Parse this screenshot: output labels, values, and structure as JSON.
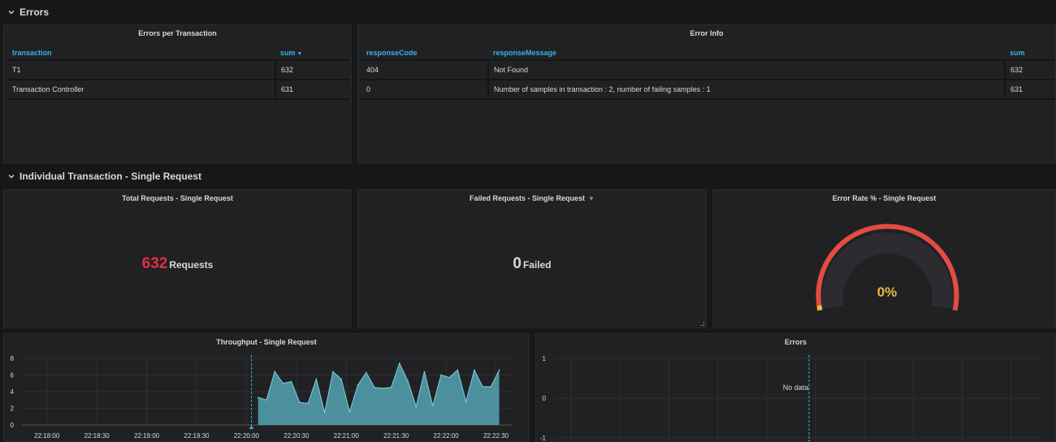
{
  "rows": {
    "errors": {
      "title": "Errors"
    },
    "individual": {
      "title": "Individual Transaction - Single Request"
    }
  },
  "errors_per_transaction": {
    "title": "Errors per Transaction",
    "columns": [
      "transaction",
      "sum"
    ],
    "rows": [
      [
        "T1",
        "632"
      ],
      [
        "Transaction Controller",
        "631"
      ]
    ]
  },
  "error_info": {
    "title": "Error Info",
    "columns": [
      "responseCode",
      "responseMessage",
      "sum"
    ],
    "rows": [
      [
        "404",
        "Not Found",
        "632"
      ],
      [
        "0",
        "Number of samples in transaction : 2, number of failing samples : 1",
        "631"
      ]
    ]
  },
  "total_requests": {
    "title": "Total Requests - Single Request",
    "value": "632",
    "unit": "Requests",
    "color": "#e02f44"
  },
  "failed_requests": {
    "title": "Failed Requests - Single Request",
    "value": "0",
    "unit": "Failed",
    "color": "#d8d9da"
  },
  "error_rate": {
    "title": "Error Rate % - Single Request",
    "value": "0%",
    "percent": 0,
    "gauge_color": "#e24d42",
    "value_color": "#eab839"
  },
  "throughput": {
    "title": "Throughput - Single Request"
  },
  "errors_chart": {
    "title": "Errors",
    "no_data": "No data"
  },
  "chart_data": [
    {
      "type": "area",
      "title": "Throughput - Single Request",
      "ylim": [
        0,
        8
      ],
      "y_ticks": [
        "0",
        "2",
        "4",
        "6",
        "8"
      ],
      "x_ticks": [
        "22:18:00",
        "22:18:30",
        "22:19:00",
        "22:19:30",
        "22:20:00",
        "22:20:30",
        "22:21:00",
        "22:21:30",
        "22:22:00",
        "22:22:30"
      ],
      "x_range": [
        "22:17:45",
        "22:22:40"
      ],
      "annotation_time": "22:20:03",
      "grid": true,
      "color": "#5bb5c7",
      "series": [
        {
          "x": [
            "22:20:07",
            "22:20:12",
            "22:20:17",
            "22:20:22",
            "22:20:27",
            "22:20:32",
            "22:20:37",
            "22:20:42",
            "22:20:47",
            "22:20:52",
            "22:20:57",
            "22:21:02",
            "22:21:07",
            "22:21:12",
            "22:21:17",
            "22:21:22",
            "22:21:27",
            "22:21:32",
            "22:21:37",
            "22:21:42",
            "22:21:47",
            "22:21:52",
            "22:21:57",
            "22:22:02",
            "22:22:07",
            "22:22:12",
            "22:22:17",
            "22:22:22",
            "22:22:27",
            "22:22:32"
          ],
          "values": [
            3.3,
            3.0,
            6.4,
            5.0,
            5.2,
            2.7,
            2.6,
            5.5,
            1.5,
            6.4,
            5.5,
            1.6,
            4.8,
            6.3,
            4.5,
            4.4,
            4.5,
            7.4,
            5.3,
            2.2,
            6.4,
            2.3,
            6.0,
            5.7,
            6.6,
            2.8,
            6.6,
            4.6,
            4.6,
            6.6
          ]
        }
      ]
    },
    {
      "type": "line",
      "title": "Errors",
      "ylim": [
        -1,
        1
      ],
      "y_ticks": [
        "1",
        "0",
        "-1"
      ],
      "grid": true,
      "series": []
    }
  ]
}
